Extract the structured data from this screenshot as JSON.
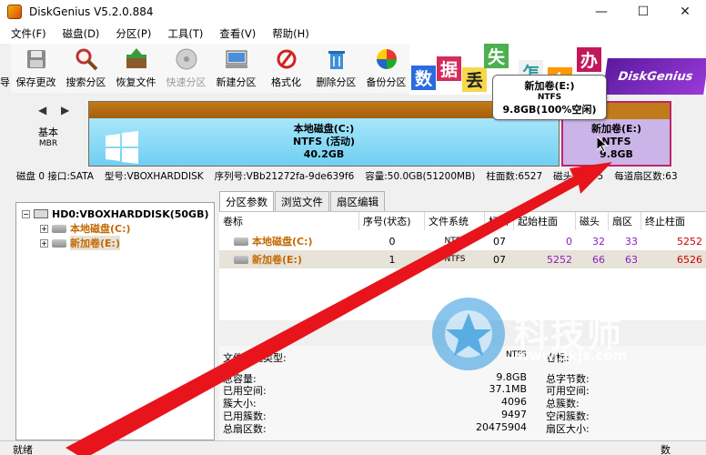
{
  "window": {
    "title": "DiskGenius V5.2.0.884",
    "controls": [
      "—",
      "☐",
      "✕"
    ]
  },
  "menu": [
    "文件(F)",
    "磁盘(D)",
    "分区(P)",
    "工具(T)",
    "查看(V)",
    "帮助(H)"
  ],
  "toolbar": {
    "left_cut": "导",
    "items": [
      {
        "label": "保存更改",
        "icon": "save-icon"
      },
      {
        "label": "搜索分区",
        "icon": "magnifier-icon"
      },
      {
        "label": "恢复文件",
        "icon": "recover-icon"
      },
      {
        "label": "快速分区",
        "icon": "quick-partition-icon"
      },
      {
        "label": "新建分区",
        "icon": "new-partition-icon"
      },
      {
        "label": "格式化",
        "icon": "format-icon"
      },
      {
        "label": "删除分区",
        "icon": "delete-icon"
      },
      {
        "label": "备份分区",
        "icon": "backup-icon"
      }
    ]
  },
  "banner": {
    "chars": [
      "数",
      "据",
      "丢",
      "失",
      "怎",
      "么",
      "办"
    ],
    "brand": "DiskGenius"
  },
  "diskmap": {
    "nav": "◀ ▶",
    "disk_type": "基本",
    "disk_table": "MBR",
    "partition_c": {
      "name": "本地磁盘(C:)",
      "fs": "NTFS (活动)",
      "size": "40.2GB"
    },
    "partition_e": {
      "name": "新加卷(E:)",
      "fs": "NTFS",
      "size": "9.8GB"
    },
    "tooltip": {
      "name": "新加卷(E:)",
      "fs": "NTFS",
      "size": "9.8GB(100%空闲)"
    }
  },
  "infoline": [
    "磁盘 0 接口:SATA",
    "型号:VBOXHARDDISK",
    "序列号:VBb21272fa-9de639f6",
    "容量:50.0GB(51200MB)",
    "柱面数:6527",
    "磁头数:255",
    "每道扇区数:63"
  ],
  "tree": {
    "disk": "HD0:VBOXHARDDISK(50GB)",
    "volumes": [
      "本地磁盘(C:)",
      "新加卷(E:)"
    ]
  },
  "tabs": [
    "分区参数",
    "浏览文件",
    "扇区编辑"
  ],
  "table": {
    "headers": [
      "卷标",
      "序号(状态)",
      "文件系统",
      "标识",
      "起始柱面",
      "磁头",
      "扇区",
      "终止柱面"
    ],
    "rows": [
      {
        "label": "本地磁盘(C:)",
        "index": "0",
        "fs": "NTFS",
        "id": "07",
        "start_cyl": "0",
        "head": "32",
        "sector": "33",
        "end_cyl": "5252"
      },
      {
        "label": "新加卷(E:)",
        "index": "1",
        "fs": "NTFS",
        "id": "07",
        "start_cyl": "5252",
        "head": "66",
        "sector": "63",
        "end_cyl": "6526"
      }
    ]
  },
  "details": {
    "fs_type_label": "文件系统类型:",
    "fs_type_value": "NTFS",
    "volume_label": "卷标:",
    "left_rows": [
      {
        "label": "总容量:",
        "value": "9.8GB"
      },
      {
        "label": "已用空间:",
        "value": "37.1MB"
      },
      {
        "label": "簇大小:",
        "value": "4096"
      },
      {
        "label": "已用簇数:",
        "value": "9497"
      },
      {
        "label": "总扇区数:",
        "value": "20475904"
      }
    ],
    "right_rows": [
      "总字节数:",
      "可用空间:",
      "总簇数:",
      "空闲簇数:",
      "扇区大小:"
    ]
  },
  "status": {
    "left": "就绪",
    "right": "数"
  },
  "watermark": {
    "text": "科技师",
    "url": "www.3kjs.com"
  },
  "colors": {
    "arrow": "#e8141c",
    "selected_border": "#c0236e",
    "partition_c": "#7fd6f5",
    "partition_e": "#cbb5e8"
  }
}
